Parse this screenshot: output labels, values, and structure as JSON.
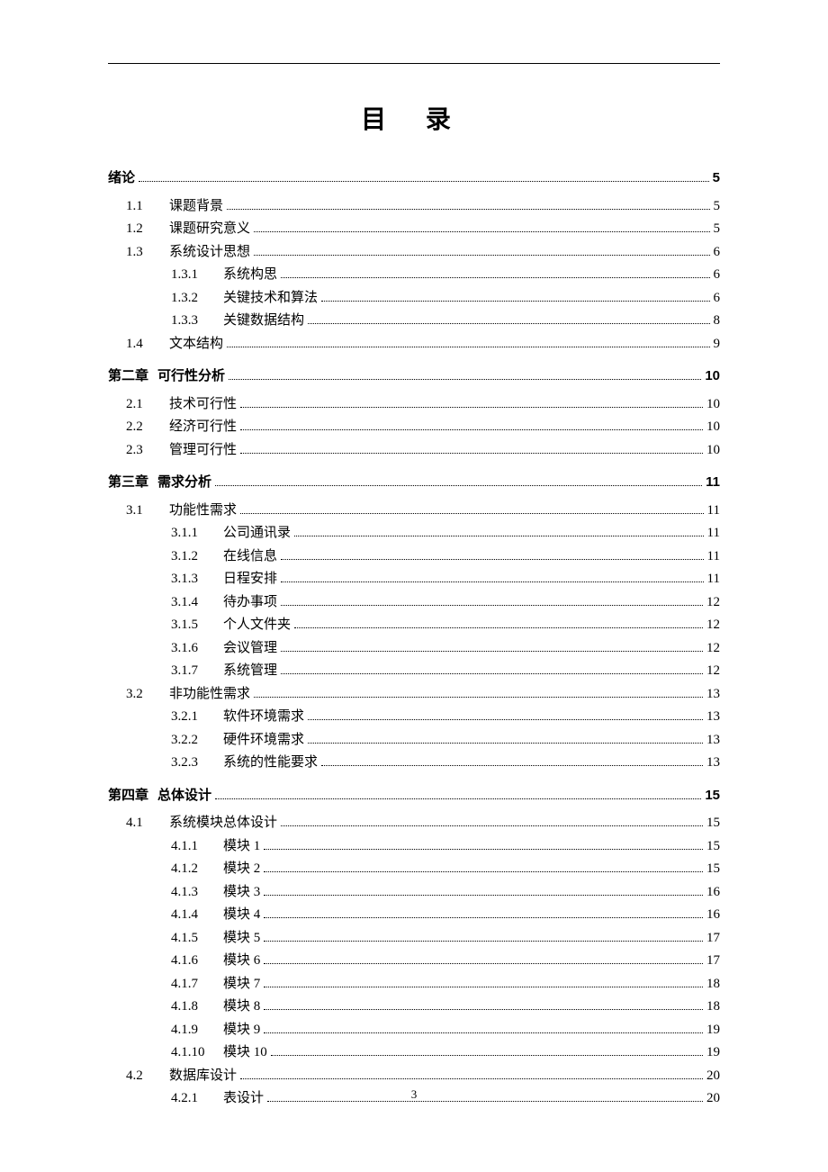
{
  "title": "目 录",
  "page_number": "3",
  "toc": [
    {
      "level": 0,
      "num": "",
      "label": "绪论",
      "page": "5"
    },
    {
      "level": 1,
      "num": "1.1",
      "label": "课题背景",
      "page": "5"
    },
    {
      "level": 1,
      "num": "1.2",
      "label": "课题研究意义",
      "page": "5"
    },
    {
      "level": 1,
      "num": "1.3",
      "label": "系统设计思想",
      "page": "6"
    },
    {
      "level": 2,
      "num": "1.3.1",
      "label": "系统构思",
      "page": "6"
    },
    {
      "level": 2,
      "num": "1.3.2",
      "label": "关键技术和算法",
      "page": "6"
    },
    {
      "level": 2,
      "num": "1.3.3",
      "label": "关键数据结构",
      "page": "8"
    },
    {
      "level": 1,
      "num": "1.4",
      "label": "文本结构",
      "page": "9"
    },
    {
      "level": 0,
      "num": "第二章",
      "label": "可行性分析",
      "page": "10"
    },
    {
      "level": 1,
      "num": "2.1",
      "label": "技术可行性",
      "page": "10"
    },
    {
      "level": 1,
      "num": "2.2",
      "label": "经济可行性",
      "page": "10"
    },
    {
      "level": 1,
      "num": "2.3",
      "label": "管理可行性",
      "page": "10"
    },
    {
      "level": 0,
      "num": "第三章",
      "label": "需求分析",
      "page": "11"
    },
    {
      "level": 1,
      "num": "3.1",
      "label": "功能性需求",
      "page": "11"
    },
    {
      "level": 2,
      "num": "3.1.1",
      "label": "公司通讯录",
      "page": "11"
    },
    {
      "level": 2,
      "num": "3.1.2",
      "label": "在线信息",
      "page": "11"
    },
    {
      "level": 2,
      "num": "3.1.3",
      "label": "日程安排",
      "page": "11"
    },
    {
      "level": 2,
      "num": "3.1.4",
      "label": "待办事项",
      "page": "12"
    },
    {
      "level": 2,
      "num": "3.1.5",
      "label": "个人文件夹",
      "page": "12"
    },
    {
      "level": 2,
      "num": "3.1.6",
      "label": "会议管理",
      "page": "12"
    },
    {
      "level": 2,
      "num": "3.1.7",
      "label": "系统管理",
      "page": "12"
    },
    {
      "level": 1,
      "num": "3.2",
      "label": "非功能性需求",
      "page": "13"
    },
    {
      "level": 2,
      "num": "3.2.1",
      "label": "软件环境需求",
      "page": "13"
    },
    {
      "level": 2,
      "num": "3.2.2",
      "label": "硬件环境需求",
      "page": "13"
    },
    {
      "level": 2,
      "num": "3.2.3",
      "label": "系统的性能要求",
      "page": "13"
    },
    {
      "level": 0,
      "num": "第四章",
      "label": "总体设计",
      "page": "15"
    },
    {
      "level": 1,
      "num": "4.1",
      "label": "系统模块总体设计",
      "page": "15"
    },
    {
      "level": 2,
      "num": "4.1.1",
      "label": "模块 1",
      "page": "15"
    },
    {
      "level": 2,
      "num": "4.1.2",
      "label": "模块 2",
      "page": "15"
    },
    {
      "level": 2,
      "num": "4.1.3",
      "label": "模块 3",
      "page": "16"
    },
    {
      "level": 2,
      "num": "4.1.4",
      "label": "模块 4",
      "page": "16"
    },
    {
      "level": 2,
      "num": "4.1.5",
      "label": "模块 5",
      "page": "17"
    },
    {
      "level": 2,
      "num": "4.1.6",
      "label": "模块 6",
      "page": "17"
    },
    {
      "level": 2,
      "num": "4.1.7",
      "label": "模块 7",
      "page": "18"
    },
    {
      "level": 2,
      "num": "4.1.8",
      "label": "模块 8",
      "page": "18"
    },
    {
      "level": 2,
      "num": "4.1.9",
      "label": "模块 9",
      "page": "19"
    },
    {
      "level": 2,
      "num": "4.1.10",
      "label": "模块 10",
      "page": "19"
    },
    {
      "level": 1,
      "num": "4.2",
      "label": "数据库设计",
      "page": "20"
    },
    {
      "level": 2,
      "num": "4.2.1",
      "label": "表设计",
      "page": "20"
    }
  ]
}
